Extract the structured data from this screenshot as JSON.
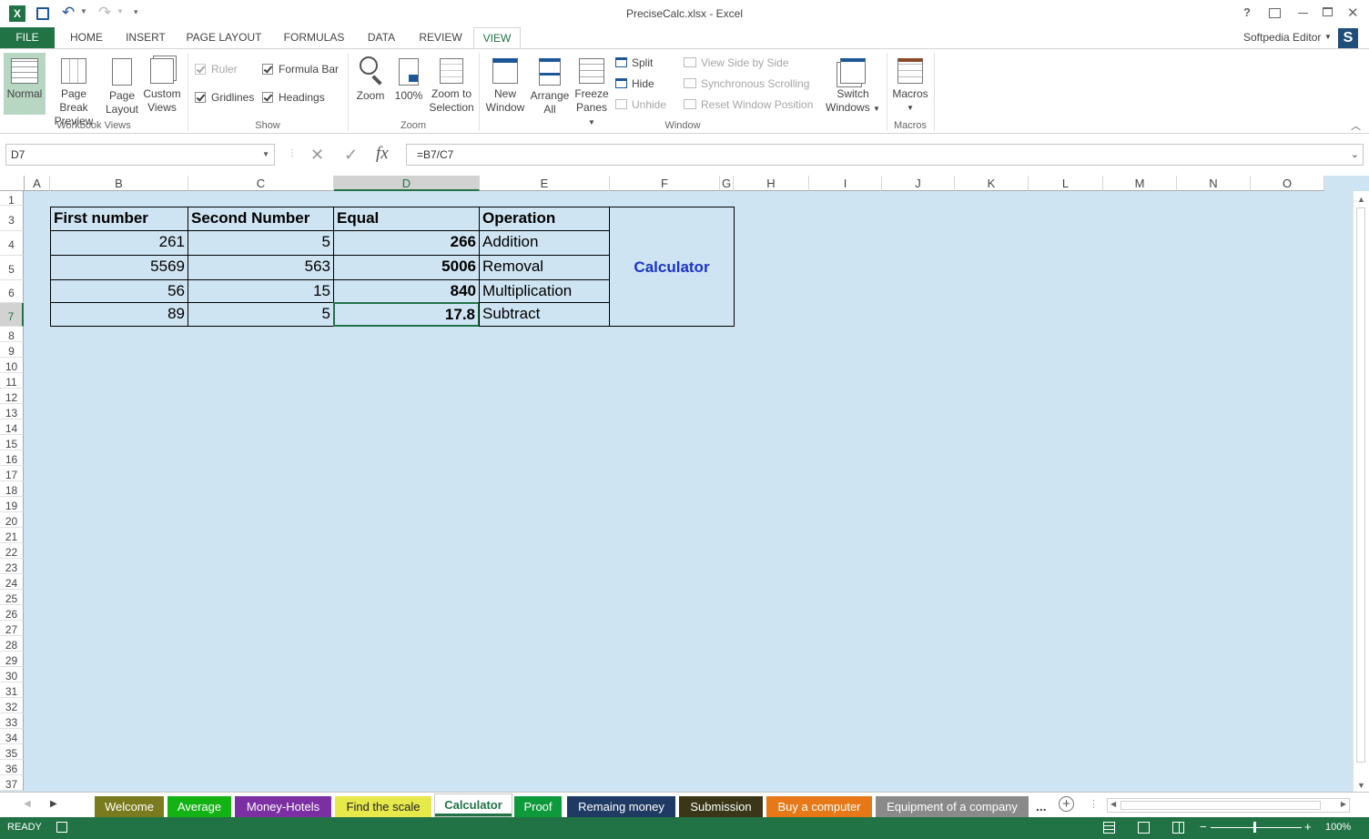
{
  "window": {
    "title": "PreciseCalc.xlsx - Excel",
    "user": "Softpedia Editor",
    "user_initial": "S"
  },
  "ribbon_tabs": [
    "FILE",
    "HOME",
    "INSERT",
    "PAGE LAYOUT",
    "FORMULAS",
    "DATA",
    "REVIEW",
    "VIEW"
  ],
  "ribbon": {
    "workbook_views": {
      "label": "Workbook Views",
      "normal": "Normal",
      "page_break_1": "Page Break",
      "page_break_2": "Preview",
      "page_layout_1": "Page",
      "page_layout_2": "Layout",
      "custom_1": "Custom",
      "custom_2": "Views"
    },
    "show": {
      "label": "Show",
      "ruler": "Ruler",
      "formula_bar": "Formula Bar",
      "gridlines": "Gridlines",
      "headings": "Headings"
    },
    "zoom": {
      "label": "Zoom",
      "zoom": "Zoom",
      "z100": "100%",
      "zsel_1": "Zoom to",
      "zsel_2": "Selection"
    },
    "window": {
      "label": "Window",
      "new_1": "New",
      "new_2": "Window",
      "arrange_1": "Arrange",
      "arrange_2": "All",
      "freeze_1": "Freeze",
      "freeze_2": "Panes",
      "split": "Split",
      "hide": "Hide",
      "unhide": "Unhide",
      "side": "View Side by Side",
      "sync": "Synchronous Scrolling",
      "reset": "Reset Window Position",
      "switch_1": "Switch",
      "switch_2": "Windows"
    },
    "macros": {
      "label": "Macros",
      "macros": "Macros"
    }
  },
  "name_box": "D7",
  "formula": "=B7/C7",
  "fx": "fx",
  "columns": [
    "A",
    "B",
    "C",
    "D",
    "E",
    "F",
    "G",
    "H",
    "I",
    "J",
    "K",
    "L",
    "M",
    "N",
    "O"
  ],
  "rows": [
    "1",
    "3",
    "4",
    "5",
    "6",
    "7",
    "8",
    "9",
    "10",
    "11",
    "12",
    "13",
    "14",
    "15",
    "16",
    "17",
    "18",
    "19",
    "20",
    "21",
    "22",
    "23",
    "24",
    "25",
    "26",
    "27",
    "28",
    "29",
    "30",
    "31",
    "32",
    "33",
    "34",
    "35",
    "36",
    "37"
  ],
  "table": {
    "headers": [
      "First number",
      "Second Number",
      "Equal",
      "Operation"
    ],
    "rows": [
      [
        "261",
        "5",
        "266",
        "Addition"
      ],
      [
        "5569",
        "563",
        "5006",
        "Removal"
      ],
      [
        "56",
        "15",
        "840",
        "Multiplication"
      ],
      [
        "89",
        "5",
        "17.8",
        "Subtract"
      ]
    ],
    "label": "Calculator"
  },
  "sheet_tabs": [
    {
      "name": "Welcome",
      "color": "#7a7a1e",
      "text": "#ffffff"
    },
    {
      "name": "Average",
      "color": "#14b314",
      "text": "#ffffff"
    },
    {
      "name": "Money-Hotels",
      "color": "#7b2fa3",
      "text": "#ffffff"
    },
    {
      "name": "Find the scale",
      "color": "#e7e84a",
      "text": "#222222"
    },
    {
      "name": "Calculator",
      "color": "#ffffff",
      "text": "#217346"
    },
    {
      "name": "Proof",
      "color": "#0e9a3a",
      "text": "#ffffff"
    },
    {
      "name": "Remaing money",
      "color": "#1f3a63",
      "text": "#ffffff"
    },
    {
      "name": "Submission",
      "color": "#3b3618",
      "text": "#ffffff"
    },
    {
      "name": "Buy a computer",
      "color": "#e67817",
      "text": "#ffffff"
    },
    {
      "name": "Equipment of a company",
      "color": "#8a8a8a",
      "text": "#ffffff"
    }
  ],
  "sheet_more": "...",
  "status": {
    "ready": "READY",
    "zoom": "100%"
  }
}
